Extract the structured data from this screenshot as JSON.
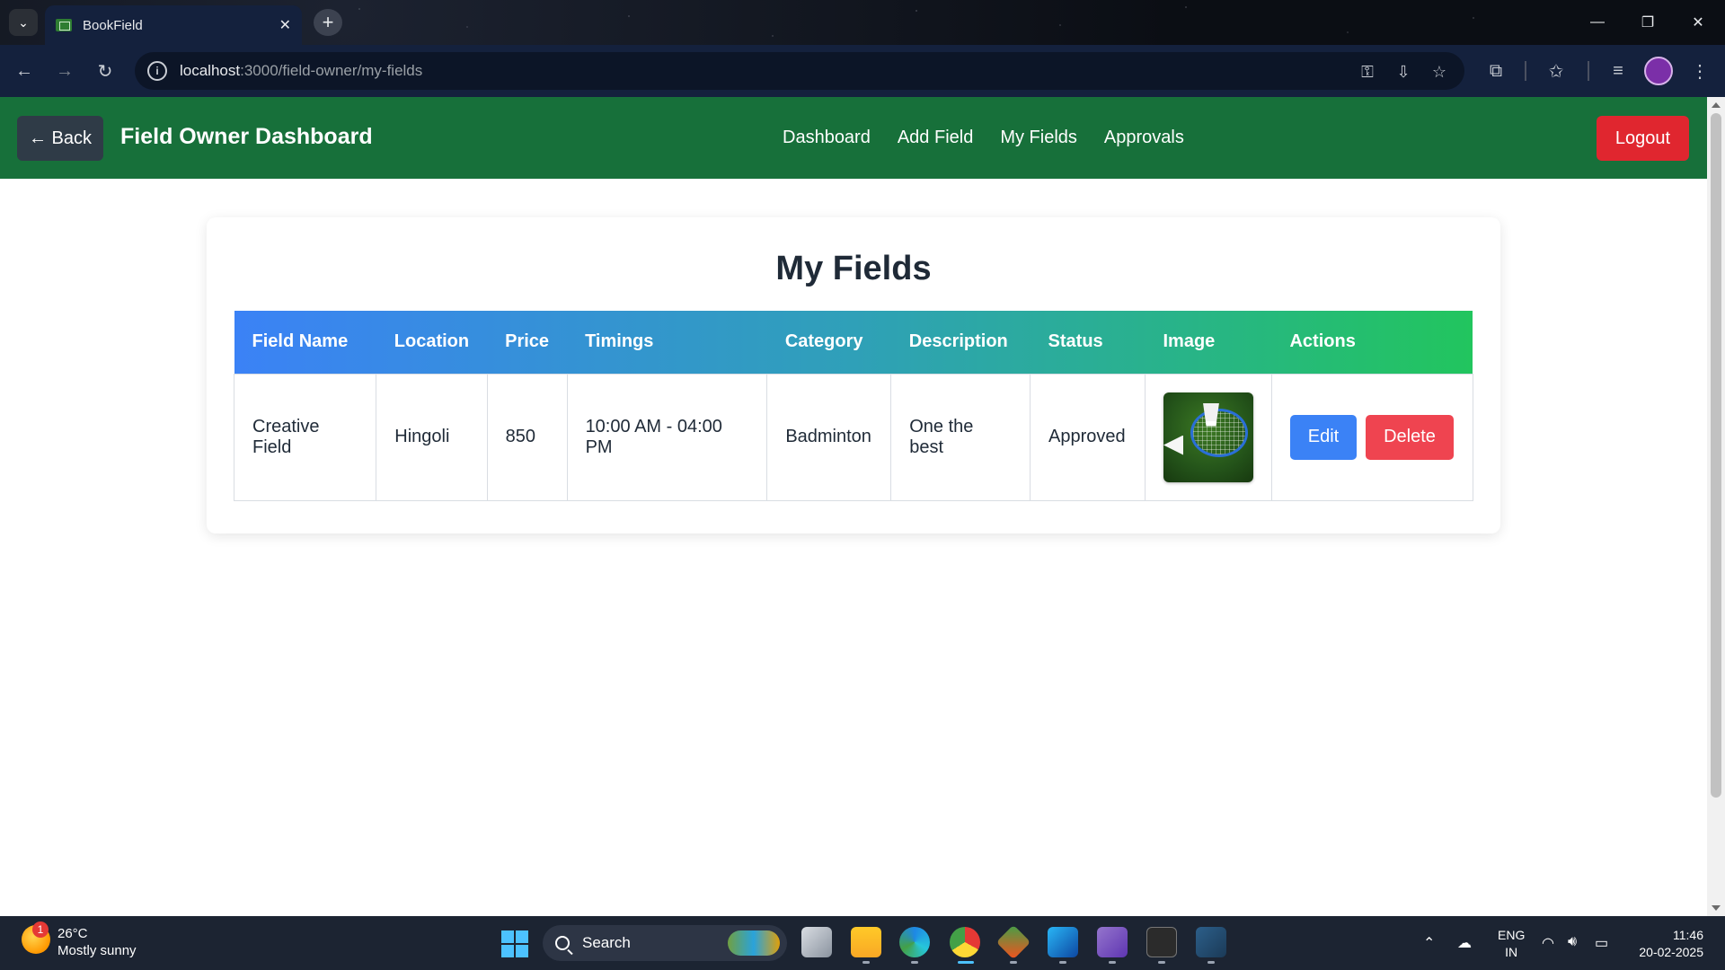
{
  "browser": {
    "tab_title": "BookField",
    "url_host": "localhost",
    "url_path": ":3000/field-owner/my-fields"
  },
  "app": {
    "back_label": "← Back",
    "dashboard_title": "Field Owner Dashboard",
    "nav": [
      "Dashboard",
      "Add Field",
      "My Fields",
      "Approvals"
    ],
    "logout_label": "Logout",
    "colors": {
      "nav_bg": "#17703a",
      "logout": "#e0262f",
      "edit": "#3b82f6",
      "delete": "#ef4450"
    }
  },
  "page": {
    "heading": "My Fields",
    "columns": [
      "Field Name",
      "Location",
      "Price",
      "Timings",
      "Category",
      "Description",
      "Status",
      "Image",
      "Actions"
    ],
    "rows": [
      {
        "field_name": "Creative Field",
        "location": "Hingoli",
        "price": "850",
        "timings": "10:00 AM - 04:00 PM",
        "category": "Badminton",
        "description": "One the best",
        "status": "Approved",
        "image": "badminton-field-thumbnail",
        "edit_label": "Edit",
        "delete_label": "Delete"
      }
    ]
  },
  "taskbar": {
    "weather_badge": "1",
    "weather_temp": "26°C",
    "weather_desc": "Mostly sunny",
    "search_label": "Search",
    "lang_1": "ENG",
    "lang_2": "IN",
    "time": "11:46",
    "date": "20-02-2025"
  }
}
